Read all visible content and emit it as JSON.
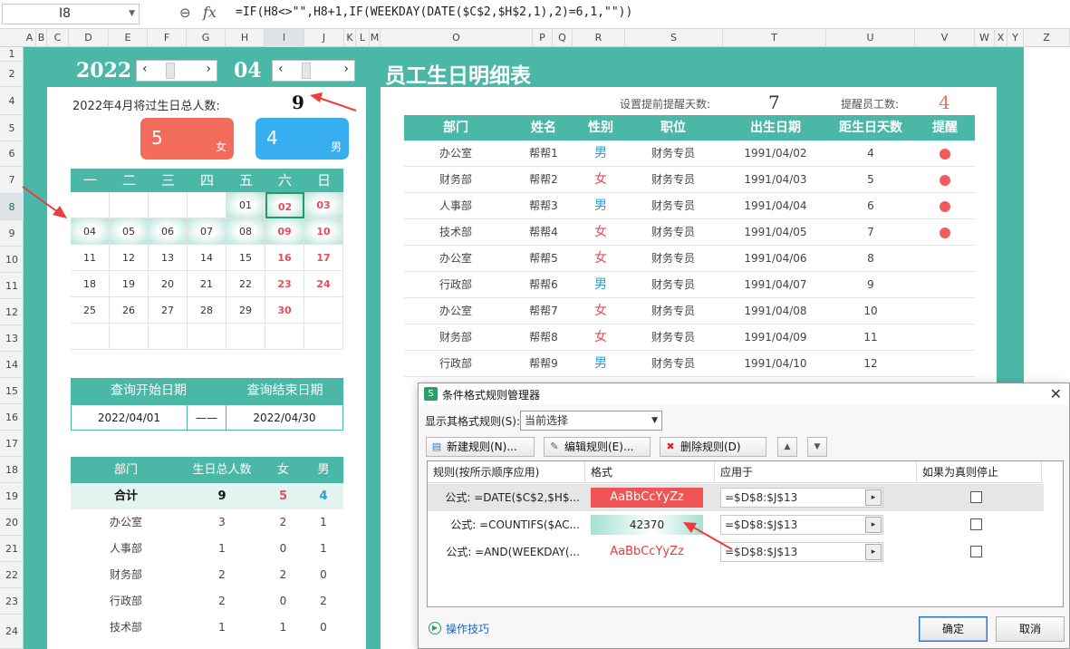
{
  "formula_bar": {
    "cell_ref": "I8",
    "formula": "=IF(H8<>\"\",H8+1,IF(WEEKDAY(DATE($C$2,$H$2,1),2)=6,1,\"\"))",
    "zoom_icon": "zoom-icon",
    "fx_icon": "fx"
  },
  "columns": [
    "A",
    "B",
    "C",
    "D",
    "E",
    "F",
    "G",
    "H",
    "I",
    "J",
    "K",
    "L",
    "M",
    "O",
    "P",
    "Q",
    "R",
    "S",
    "T",
    "U",
    "V",
    "W",
    "X",
    "Y",
    "Z"
  ],
  "rows": [
    "1",
    "2",
    "4",
    "5",
    "6",
    "7",
    "8",
    "9",
    "10",
    "11",
    "12",
    "13",
    "14",
    "15",
    "16",
    "17",
    "18",
    "19",
    "20",
    "21",
    "22",
    "23",
    "24"
  ],
  "header": {
    "year": "2022",
    "month": "04",
    "title": "员工生日明细表"
  },
  "summary": {
    "label": "2022年4月将过生日总人数:",
    "total": "9",
    "female_count": "5",
    "female_label": "女",
    "male_count": "4",
    "male_label": "男"
  },
  "calendar": {
    "weekdays": [
      "一",
      "二",
      "三",
      "四",
      "五",
      "六",
      "日"
    ],
    "weeks": [
      [
        "",
        "",
        "",
        "",
        "01",
        "02",
        "03"
      ],
      [
        "04",
        "05",
        "06",
        "07",
        "08",
        "09",
        "10"
      ],
      [
        "11",
        "12",
        "13",
        "14",
        "15",
        "16",
        "17"
      ],
      [
        "18",
        "19",
        "20",
        "21",
        "22",
        "23",
        "24"
      ],
      [
        "25",
        "26",
        "27",
        "28",
        "29",
        "30",
        ""
      ],
      [
        "",
        "",
        "",
        "",
        "",
        "",
        ""
      ]
    ]
  },
  "query": {
    "start_label": "查询开始日期",
    "end_label": "查询结束日期",
    "start_date": "2022/04/01",
    "separator": "——",
    "end_date": "2022/04/30"
  },
  "dept_summary": {
    "headers": [
      "部门",
      "生日总人数",
      "女",
      "男"
    ],
    "total_row": [
      "合计",
      "9",
      "5",
      "4"
    ],
    "rows": [
      [
        "办公室",
        "3",
        "2",
        "1"
      ],
      [
        "人事部",
        "1",
        "0",
        "1"
      ],
      [
        "财务部",
        "2",
        "2",
        "0"
      ],
      [
        "行政部",
        "2",
        "0",
        "2"
      ],
      [
        "技术部",
        "1",
        "1",
        "0"
      ]
    ]
  },
  "settings": {
    "remind_days_label": "设置提前提醒天数:",
    "remind_days": "7",
    "remind_count_label": "提醒员工数:",
    "remind_count": "4"
  },
  "employee_table": {
    "headers": [
      "部门",
      "姓名",
      "性别",
      "职位",
      "出生日期",
      "距生日天数",
      "提醒"
    ],
    "rows": [
      {
        "dept": "办公室",
        "name": "帮帮1",
        "gender": "男",
        "title": "财务专员",
        "birth": "1991/04/02",
        "days": "4",
        "remind": true
      },
      {
        "dept": "财务部",
        "name": "帮帮2",
        "gender": "女",
        "title": "财务专员",
        "birth": "1991/04/03",
        "days": "5",
        "remind": true
      },
      {
        "dept": "人事部",
        "name": "帮帮3",
        "gender": "男",
        "title": "财务专员",
        "birth": "1991/04/04",
        "days": "6",
        "remind": true
      },
      {
        "dept": "技术部",
        "name": "帮帮4",
        "gender": "女",
        "title": "财务专员",
        "birth": "1991/04/05",
        "days": "7",
        "remind": true
      },
      {
        "dept": "办公室",
        "name": "帮帮5",
        "gender": "女",
        "title": "财务专员",
        "birth": "1991/04/06",
        "days": "8",
        "remind": false
      },
      {
        "dept": "行政部",
        "name": "帮帮6",
        "gender": "男",
        "title": "财务专员",
        "birth": "1991/04/07",
        "days": "9",
        "remind": false
      },
      {
        "dept": "办公室",
        "name": "帮帮7",
        "gender": "女",
        "title": "财务专员",
        "birth": "1991/04/08",
        "days": "10",
        "remind": false
      },
      {
        "dept": "财务部",
        "name": "帮帮8",
        "gender": "女",
        "title": "财务专员",
        "birth": "1991/04/09",
        "days": "11",
        "remind": false
      },
      {
        "dept": "行政部",
        "name": "帮帮9",
        "gender": "男",
        "title": "财务专员",
        "birth": "1991/04/10",
        "days": "12",
        "remind": false
      }
    ]
  },
  "dialog": {
    "title": "条件格式规则管理器",
    "show_label": "显示其格式规则(S):",
    "show_value": "当前选择",
    "new_rule": "新建规则(N)...",
    "edit_rule": "编辑规则(E)...",
    "delete_rule": "删除规则(D)",
    "headers": [
      "规则(按所示顺序应用)",
      "格式",
      "应用于",
      "如果为真则停止"
    ],
    "rules": [
      {
        "condition": "公式: =DATE($C$2,$H$...",
        "preview": "AaBbCcYyZz",
        "applies": "=$D$8:$J$13"
      },
      {
        "condition": "公式: =COUNTIFS($AC...",
        "preview": "42370",
        "applies": "=$D$8:$J$13"
      },
      {
        "condition": "公式: =AND(WEEKDAY(...",
        "preview": "AaBbCcYyZz",
        "applies": "=$D$8:$J$13"
      }
    ],
    "tips": "操作技巧",
    "ok": "确定",
    "cancel": "取消"
  },
  "colors": {
    "teal": "#4bb8a7",
    "female_card": "#f36c5b",
    "male_card": "#36aef0",
    "weekend_red": "#e84c5a",
    "male_blue": "#2a9fd6",
    "alert_dot": "#f05b5b"
  }
}
